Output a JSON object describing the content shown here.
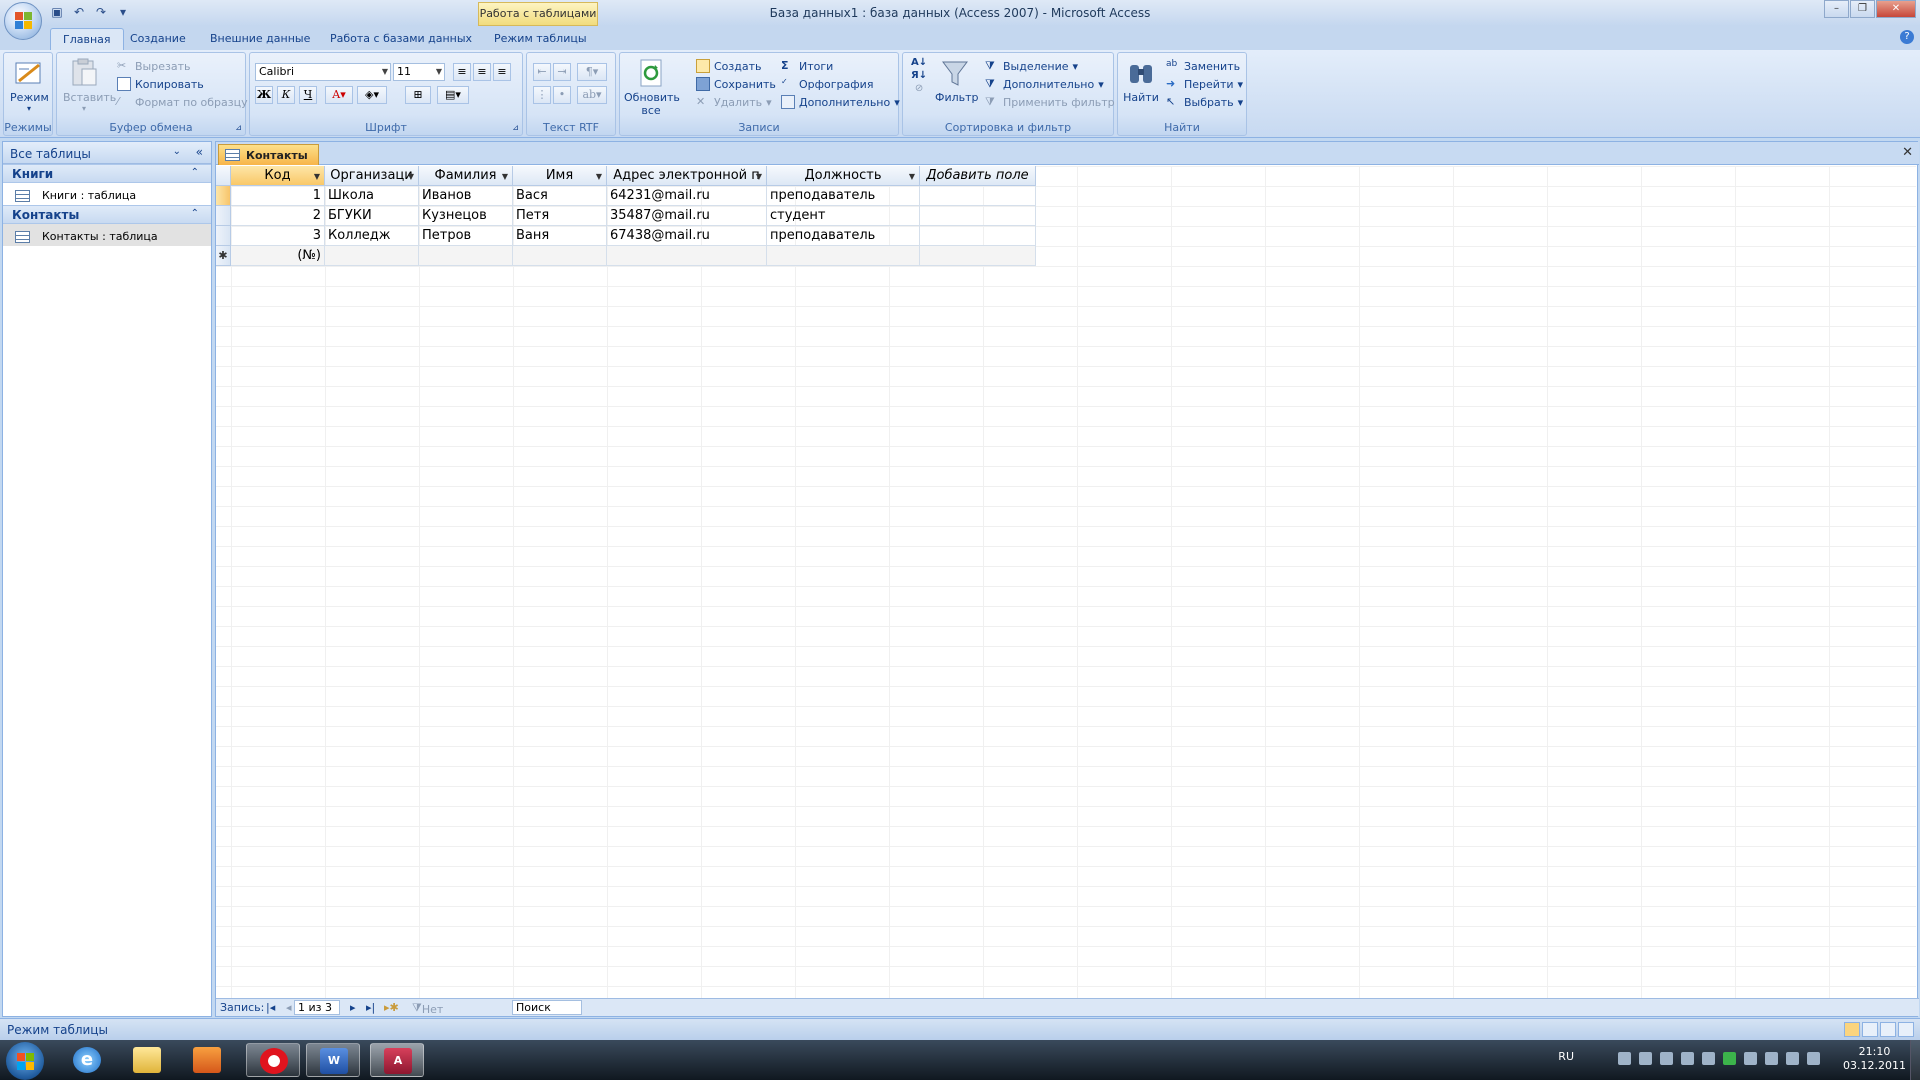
{
  "window": {
    "title": "База данных1 : база данных (Access 2007) - Microsoft Access",
    "context_tab_group": "Работа с таблицами"
  },
  "tabs": [
    {
      "label": "Главная",
      "active": true
    },
    {
      "label": "Создание"
    },
    {
      "label": "Внешние данные"
    },
    {
      "label": "Работа с базами данных"
    },
    {
      "label": "Режим таблицы"
    }
  ],
  "ribbon": {
    "views": {
      "mode": "Режим",
      "group": "Режимы"
    },
    "clipboard": {
      "paste": "Вставить",
      "cut": "Вырезать",
      "copy": "Копировать",
      "format_painter": "Формат по образцу",
      "group": "Буфер обмена"
    },
    "font": {
      "family": "Calibri",
      "size": "11",
      "bold": "Ж",
      "italic": "К",
      "underline": "Ч",
      "group": "Шрифт"
    },
    "rtf": {
      "group": "Текст RTF"
    },
    "records": {
      "refresh": "Обновить все",
      "new": "Создать",
      "save": "Сохранить",
      "delete": "Удалить",
      "totals": "Итоги",
      "spelling": "Орфография",
      "more": "Дополнительно",
      "group": "Записи"
    },
    "sort_filter": {
      "filter": "Фильтр",
      "selection": "Выделение",
      "advanced": "Дополнительно",
      "toggle": "Применить фильтр",
      "group": "Сортировка и фильтр"
    },
    "find": {
      "find": "Найти",
      "replace": "Заменить",
      "goto": "Перейти",
      "select": "Выбрать",
      "group": "Найти"
    }
  },
  "nav": {
    "header": "Все таблицы",
    "groups": [
      {
        "name": "Книги",
        "items": [
          "Книги : таблица"
        ]
      },
      {
        "name": "Контакты",
        "items": [
          "Контакты : таблица"
        ]
      }
    ]
  },
  "document": {
    "tab": "Контакты",
    "columns": [
      "Код",
      "Организаци",
      "Фамилия",
      "Имя",
      "Адрес электронной п",
      "Должность",
      "Добавить поле"
    ],
    "rows": [
      [
        "1",
        "Школа",
        "Иванов",
        "Вася",
        "64231@mail.ru",
        "преподаватель"
      ],
      [
        "2",
        "БГУКИ",
        "Кузнецов",
        "Петя",
        "35487@mail.ru",
        "студент"
      ],
      [
        "3",
        "Колледж",
        "Петров",
        "Ваня",
        "67438@mail.ru",
        "преподаватель"
      ]
    ],
    "new_row_marker": "(№)"
  },
  "record_nav": {
    "label": "Запись:",
    "position": "1 из 3",
    "filter": "Нет фильтра",
    "search": "Поиск"
  },
  "status": {
    "text": "Режим таблицы"
  },
  "taskbar": {
    "language": "RU",
    "time": "21:10",
    "date": "03.12.2011"
  }
}
